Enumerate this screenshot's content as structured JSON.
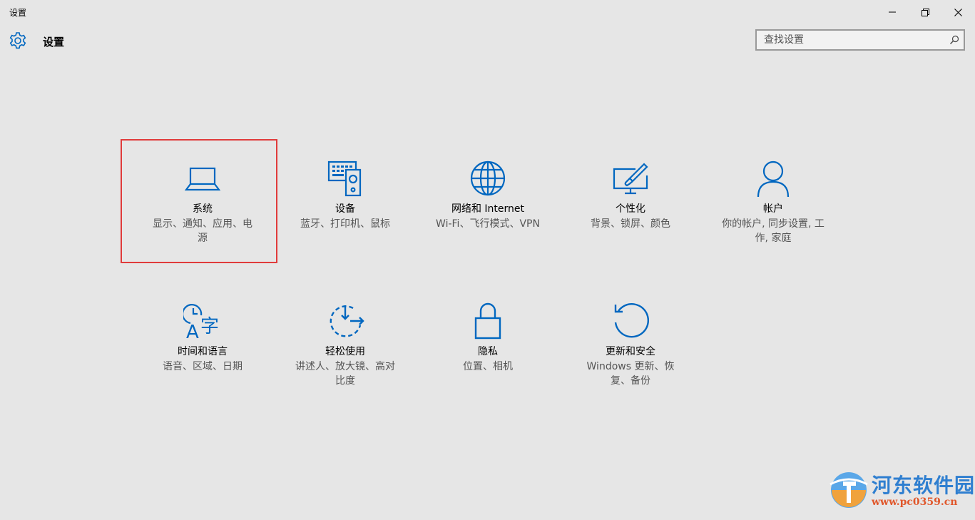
{
  "window": {
    "title": "设置",
    "controls": {
      "minimize": "minimize-icon",
      "restore": "restore-icon",
      "close": "close-icon"
    }
  },
  "header": {
    "title": "设置",
    "icon": "gear-icon"
  },
  "search": {
    "placeholder": "查找设置",
    "icon": "search-icon"
  },
  "colors": {
    "accent": "#0067c0",
    "background": "#e6e6e6",
    "highlight": "#e03b3b"
  },
  "tiles": [
    {
      "name": "系统",
      "desc": "显示、通知、应用、电源",
      "icon": "laptop-icon"
    },
    {
      "name": "设备",
      "desc": "蓝牙、打印机、鼠标",
      "icon": "devices-icon"
    },
    {
      "name": "网络和 Internet",
      "desc": "Wi-Fi、飞行模式、VPN",
      "icon": "globe-icon"
    },
    {
      "name": "个性化",
      "desc": "背景、锁屏、颜色",
      "icon": "personalization-icon"
    },
    {
      "name": "帐户",
      "desc": "你的帐户, 同步设置, 工作, 家庭",
      "icon": "person-icon"
    },
    {
      "name": "时间和语言",
      "desc": "语音、区域、日期",
      "icon": "time-language-icon"
    },
    {
      "name": "轻松使用",
      "desc": "讲述人、放大镜、高对比度",
      "icon": "ease-of-access-icon"
    },
    {
      "name": "隐私",
      "desc": "位置、相机",
      "icon": "lock-icon"
    },
    {
      "name": "更新和安全",
      "desc": "Windows 更新、恢复、备份",
      "icon": "update-icon"
    }
  ],
  "watermark": {
    "title": "河东软件园",
    "url": "www.pc0359.cn",
    "icon": "watermark-logo-icon"
  }
}
